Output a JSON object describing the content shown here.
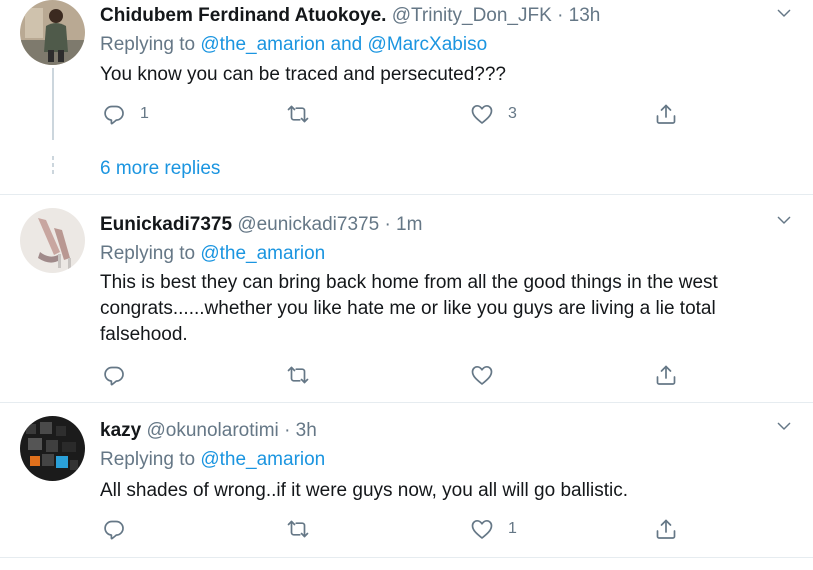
{
  "tweets": [
    {
      "name": "Chidubem Ferdinand Atuokoye.",
      "handle": "@Trinity_Don_JFK",
      "separator": "·",
      "time": "13h",
      "replying_prefix": "Replying to",
      "mentions": [
        "@the_amarion",
        "@MarcXabiso"
      ],
      "mention_joiner": "and",
      "text": "You know you can be traced and persecuted???",
      "reply_count": "1",
      "retweet_count": "",
      "like_count": "3"
    },
    {
      "name": "Eunickadi7375",
      "handle": "@eunickadi7375",
      "separator": "·",
      "time": "1m",
      "replying_prefix": "Replying to",
      "mentions": [
        "@the_amarion"
      ],
      "text": "This is best they can bring back home from all the good things in the west congrats......whether you like hate me or like you guys are living a lie total falsehood.",
      "reply_count": "",
      "retweet_count": "",
      "like_count": ""
    },
    {
      "name": "kazy",
      "handle": "@okunolarotimi",
      "separator": "·",
      "time": "3h",
      "replying_prefix": "Replying to",
      "mentions": [
        "@the_amarion"
      ],
      "text": "All shades of wrong..if it were guys now, you all will go ballistic.",
      "reply_count": "",
      "retweet_count": "",
      "like_count": "1"
    }
  ],
  "more_replies": "6 more replies",
  "icons": {
    "reply": "reply-icon",
    "retweet": "retweet-icon",
    "like": "heart-icon",
    "share": "share-icon",
    "menu": "chevron-down-icon"
  },
  "colors": {
    "link": "#1b95e0",
    "muted": "#657786",
    "text": "#14171a",
    "divider": "#e6ecf0"
  }
}
